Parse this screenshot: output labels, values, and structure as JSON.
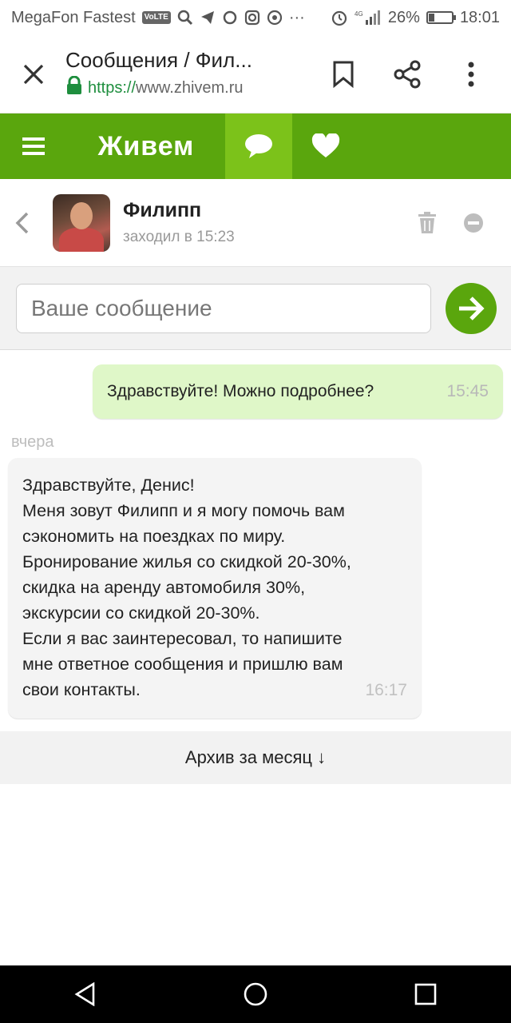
{
  "status_bar": {
    "carrier": "MegaFon Fastest",
    "volte_label": "VoLTE",
    "network": "4G",
    "battery_percent_text": "26%",
    "battery_level": 0.26,
    "time": "18:01",
    "more": "···"
  },
  "browser": {
    "title": "Сообщения / Фил...",
    "url_scheme": "https://",
    "url_host": "www.zhivem.ru"
  },
  "site_header": {
    "logo_text": "Живем"
  },
  "contact": {
    "name": "Филипп",
    "last_seen": "заходил в 15:23"
  },
  "composer": {
    "placeholder": "Ваше сообщение"
  },
  "messages": {
    "outgoing": {
      "text": "Здравствуйте! Можно подробнее?",
      "time": "15:45"
    },
    "day_label": "вчера",
    "incoming": {
      "lines": [
        "Здравствуйте, Денис!",
        "Меня зовут Филипп и я могу помочь вам",
        "сэкономить на поездках по миру.",
        "Бронирование жилья со скидкой 20-30%,",
        "скидка на аренду автомобиля 30%,",
        "экскурсии со скидкой 20-30%.",
        "Если я вас заинтересовал, то напишите",
        "мне ответное сообщения и пришлю вам",
        "свои контакты."
      ],
      "time": "16:17"
    }
  },
  "archive_label": "Архив за месяц ↓",
  "colors": {
    "brand_green": "#5aa60d",
    "active_tab_green": "#7cc21a",
    "outgoing_bubble": "#dff7c8",
    "incoming_bubble": "#f4f4f4"
  }
}
